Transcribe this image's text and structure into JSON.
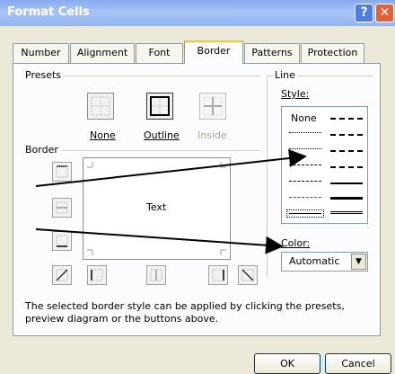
{
  "window": {
    "title": "Format Cells",
    "help_glyph": "?",
    "close_glyph": "✕"
  },
  "tabs": [
    {
      "label": "Number"
    },
    {
      "label": "Alignment"
    },
    {
      "label": "Font"
    },
    {
      "label": "Border",
      "active": true
    },
    {
      "label": "Patterns"
    },
    {
      "label": "Protection"
    }
  ],
  "presets": {
    "group_label": "Presets",
    "none_label": "None",
    "outline_label": "Outline",
    "inside_label": "Inside"
  },
  "border": {
    "group_label": "Border",
    "preview_text": "Text"
  },
  "line": {
    "group_label": "Line",
    "style_label": "Style:",
    "none_option": "None",
    "color_label": "Color:",
    "color_value": "Automatic"
  },
  "hint": "The selected border style can be applied by clicking the presets, preview diagram or the buttons above.",
  "buttons": {
    "ok": "OK",
    "cancel": "Cancel"
  },
  "colors": {
    "title_bar": "#94b5f2",
    "dialog_bg": "#ece9d8",
    "active_tab_highlight": "#f4c430",
    "arrow": "#000000"
  }
}
